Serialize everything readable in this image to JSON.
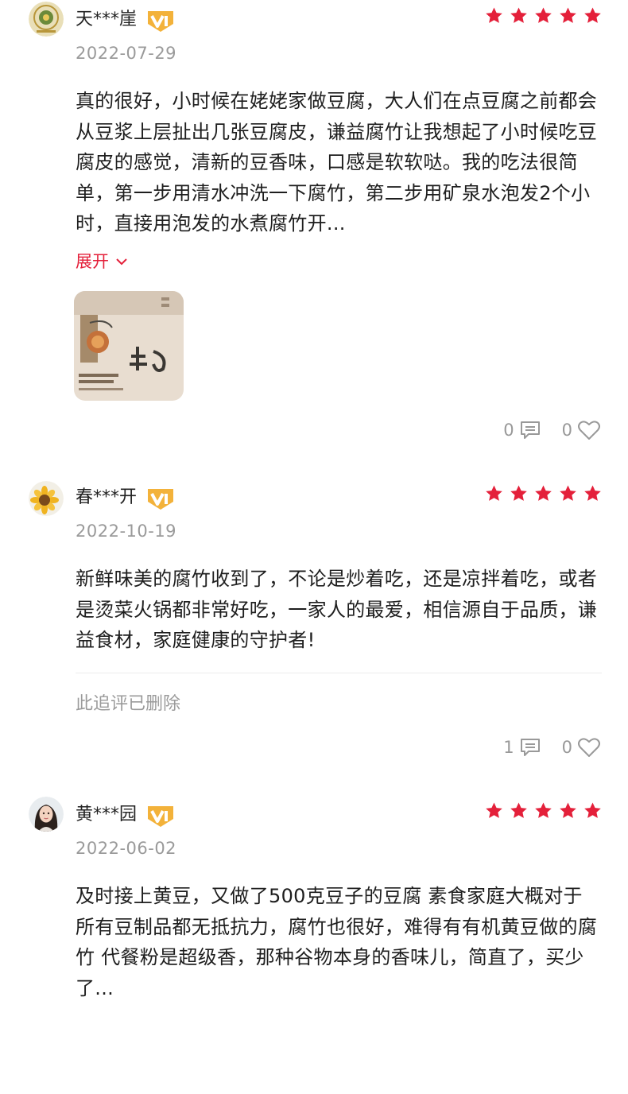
{
  "colors": {
    "star": "#e4203a",
    "vip_gold": "#f3b23a",
    "expand": "#e4203a"
  },
  "reviews": [
    {
      "username": "天***崖",
      "date": "2022-07-29",
      "rating": 5,
      "content": "真的很好，小时候在姥姥家做豆腐，大人们在点豆腐之前都会从豆浆上层扯出几张豆腐皮，谦益腐竹让我想起了小时候吃豆腐皮的感觉，清新的豆香味，口感是软软哒。我的吃法很简单，第一步用清水冲洗一下腐竹，第二步用矿泉水泡发2个小时，直接用泡发的水煮腐竹开...",
      "expand_label": "展开",
      "comments": "0",
      "likes": "0"
    },
    {
      "username": "春***开",
      "date": "2022-10-19",
      "rating": 5,
      "content": "新鲜味美的腐竹收到了，不论是炒着吃，还是凉拌着吃，或者是烫菜火锅都非常好吃，一家人的最爱，相信源自于品质，谦益食材，家庭健康的守护者!",
      "followup": "此追评已删除",
      "comments": "1",
      "likes": "0"
    },
    {
      "username": "黄***园",
      "date": "2022-06-02",
      "rating": 5,
      "content": "及时接上黄豆，又做了500克豆子的豆腐 素食家庭大概对于所有豆制品都无抵抗力，腐竹也很好，难得有有机黄豆做的腐竹 代餐粉是超级香，那种谷物本身的香味儿，简直了，买少了..."
    }
  ]
}
